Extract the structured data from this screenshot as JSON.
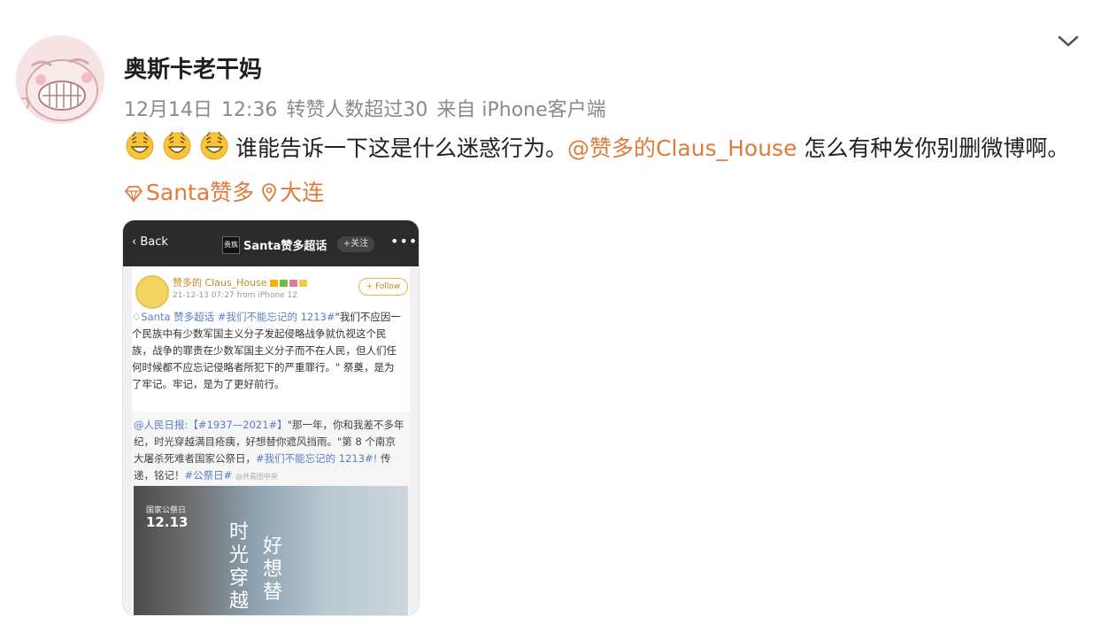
{
  "author": {
    "name": "奥斯卡老干妈"
  },
  "meta": {
    "date": "12月14日",
    "time": "12:36",
    "reposts": "转赞人数超过30",
    "source": "来自 iPhone客户端"
  },
  "post": {
    "text_main": "谁能告诉一下这是什么迷惑行为。",
    "mention": "@赞多的Claus_House",
    "text_after": " 怎么有种发你别删微博啊。",
    "topic_link": "Santa赞多",
    "location": "大连"
  },
  "screenshot": {
    "back_label": "Back",
    "logo_text": "贵族",
    "title": "Santa赞多超话",
    "follow_chip": "+关注",
    "more": "•••",
    "card": {
      "username": "赞多的 Claus_House",
      "time": "21-12-13 07:27",
      "from": "from iPhone 12",
      "follow": "+ Follow",
      "topic": "Santa 赞多超话",
      "hashtag": "#我们不能忘记的 1213#",
      "body": "\"我们不应因一个民族中有少数军国主义分子发起侵略战争就仇视这个民族，战争的罪责在少数军国主义分子而不在人民，但人们任何时候都不应忘记侵略者所犯下的严重罪行。\" 祭奠，是为了牢记。牢记，是为了更好前行。"
    },
    "quote": {
      "source": "@人民日报:",
      "hashtag1": "【#1937—2021#】",
      "text1": "\"那一年，你和我差不多年纪，时光穿越满目疮痍，好想替你遮风挡雨。\"第 8 个南京大屠杀死难者国家公祭日，",
      "hashtag2": "#我们不能忘记的 1213#!",
      "text2": " 传递，铭记！",
      "hashtag3": "#公祭日#",
      "watermark": "@共青团中央"
    },
    "image": {
      "small_label": "国家公祭日",
      "date": "12.13",
      "callig_1": "时光穿越",
      "callig_2": "好想替"
    }
  },
  "colors": {
    "link": "#e07a3a",
    "meta": "#8a8a8a",
    "tag": "#5b7ec7"
  }
}
